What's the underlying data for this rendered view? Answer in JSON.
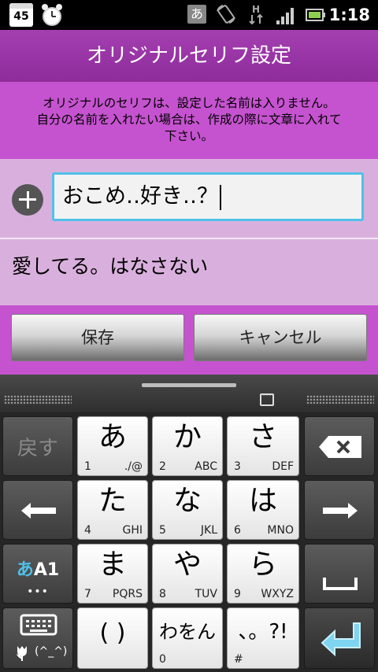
{
  "status_bar": {
    "calendar_day": "45",
    "ime_indicator": "あ",
    "time": "1:18",
    "icons": [
      "calendar-icon",
      "alarm-clock-icon",
      "ime-icon",
      "rotation-icon",
      "h-network-icon",
      "signal-icon",
      "battery-icon"
    ]
  },
  "title": "オリジナルセリフ設定",
  "description": {
    "line1": "オリジナルのセリフは、設定した名前は入りません。",
    "line2": "自分の名前を入れたい場合は、作成の際に文章に入れて",
    "line3": "下さい。"
  },
  "input": {
    "value": "おこめ‥好き‥？"
  },
  "saved_items": [
    {
      "text": "愛してる。はなさない"
    }
  ],
  "buttons": {
    "save": "保存",
    "cancel": "キャンセル"
  },
  "keyboard": {
    "undo": "戻す",
    "mode_hira": "あ",
    "mode_alnum": "A1",
    "mode_dots": "•••",
    "emoji_label": "(^_^)",
    "keys": [
      {
        "main": "あ",
        "num": "1",
        "sub": "./@"
      },
      {
        "main": "か",
        "num": "2",
        "sub": "ABC"
      },
      {
        "main": "さ",
        "num": "3",
        "sub": "DEF"
      },
      {
        "main": "た",
        "num": "4",
        "sub": "GHI"
      },
      {
        "main": "な",
        "num": "5",
        "sub": "JKL"
      },
      {
        "main": "は",
        "num": "6",
        "sub": "MNO"
      },
      {
        "main": "ま",
        "num": "7",
        "sub": "PQRS"
      },
      {
        "main": "や",
        "num": "8",
        "sub": "TUV"
      },
      {
        "main": "ら",
        "num": "9",
        "sub": "WXYZ"
      },
      {
        "main": "( )",
        "num": "",
        "sub": ""
      },
      {
        "main": "わをん",
        "num": "0",
        "sub": ""
      },
      {
        "main": "、。?!",
        "num": "#",
        "sub": ""
      }
    ]
  },
  "colors": {
    "title_bg": "#9b36aa",
    "panel_bg": "#c553cf",
    "row_bg": "#d9b0dd",
    "input_border": "#4fc1e9"
  }
}
